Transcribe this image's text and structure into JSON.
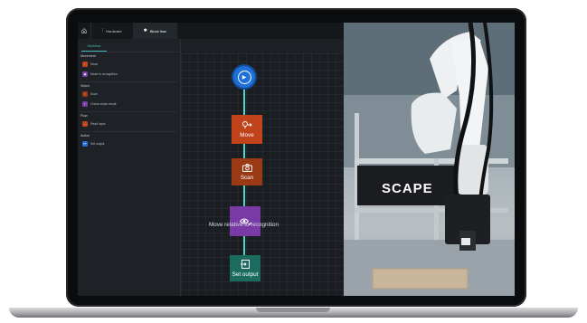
{
  "topbar": {
    "tabs": [
      {
        "label": "Hardware",
        "icon": "sliders-icon"
      },
      {
        "label": "Block flow",
        "icon": "gear-icon"
      }
    ]
  },
  "sidebar": {
    "tab_label": "Workflow",
    "groups": [
      {
        "title": "Movement",
        "items": [
          {
            "label": "Move",
            "color": "#c0431c",
            "icon": "move-icon"
          },
          {
            "label": "Move to recognition",
            "color": "#7a3aa6",
            "icon": "eye-icon"
          }
        ]
      },
      {
        "title": "Vision",
        "items": [
          {
            "label": "Scan",
            "color": "#9a3a14",
            "icon": "camera-icon"
          },
          {
            "label": "Check vision result",
            "color": "#7a3aa6",
            "icon": "check-icon"
          }
        ]
      },
      {
        "title": "Flow",
        "items": [
          {
            "label": "Read input",
            "color": "#c0431c",
            "icon": "input-icon"
          }
        ]
      },
      {
        "title": "Action",
        "items": [
          {
            "label": "Set output",
            "color": "#1e6fd8",
            "icon": "output-icon"
          }
        ]
      }
    ]
  },
  "flow": {
    "start_icon": "play-icon",
    "nodes": [
      {
        "label": "Move",
        "icon": "move-icon",
        "color": "#c0431c"
      },
      {
        "label": "Scan",
        "icon": "camera-icon",
        "color": "#9a3a14"
      },
      {
        "label": "Move relative to recognition",
        "icon": "eye-icon",
        "color": "#7a3aa6"
      },
      {
        "label": "Set output",
        "icon": "output-icon",
        "color": "#1b6b5e"
      }
    ],
    "connector_color": "#4cd6c8"
  },
  "photo": {
    "sign_text": "SCAPE"
  }
}
